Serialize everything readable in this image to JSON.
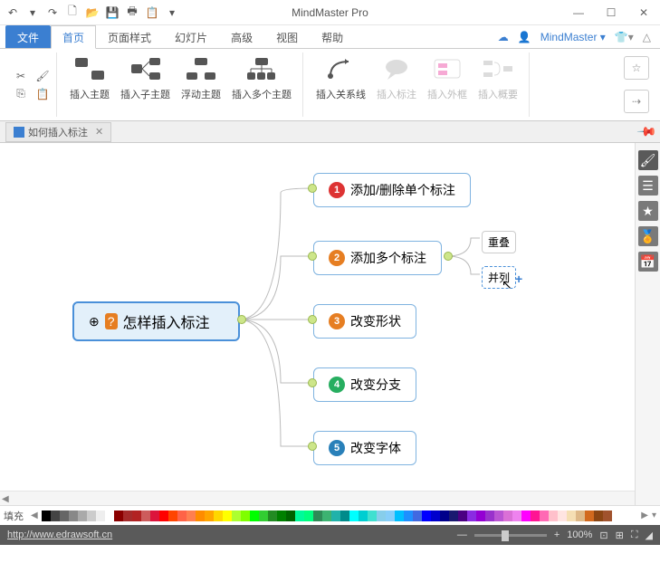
{
  "app": {
    "title": "MindMaster Pro",
    "brand": "MindMaster"
  },
  "tabs": {
    "file": "文件",
    "items": [
      "首页",
      "页面样式",
      "幻灯片",
      "高级",
      "视图",
      "帮助"
    ],
    "active": 0
  },
  "ribbon": {
    "insert_topic": "插入主题",
    "insert_subtopic": "插入子主题",
    "floating_topic": "浮动主题",
    "insert_multiple": "插入多个主题",
    "relationship": "插入关系线",
    "callout": "插入标注",
    "boundary": "插入外框",
    "summary": "插入概要"
  },
  "doc": {
    "name": "如何插入标注",
    "close": "✕"
  },
  "mindmap": {
    "center": "怎样插入标注",
    "nodes": [
      "添加/删除单个标注",
      "添加多个标注",
      "改变形状",
      "改变分支",
      "改变字体"
    ],
    "sub": {
      "overlap": "重叠",
      "side": "并列"
    }
  },
  "palette": {
    "label": "填充"
  },
  "status": {
    "url": "http://www.edrawsoft.cn",
    "zoom": "100%"
  },
  "colors": [
    "#000",
    "#444",
    "#666",
    "#888",
    "#aaa",
    "#ccc",
    "#eee",
    "#fff",
    "#8b0000",
    "#a52a2a",
    "#b22222",
    "#cd5c5c",
    "#dc143c",
    "#ff0000",
    "#ff4500",
    "#ff6347",
    "#ff7f50",
    "#ff8c00",
    "#ffa500",
    "#ffd700",
    "#ffff00",
    "#adff2f",
    "#7fff00",
    "#00ff00",
    "#32cd32",
    "#228b22",
    "#008000",
    "#006400",
    "#00fa9a",
    "#00ff7f",
    "#2e8b57",
    "#3cb371",
    "#20b2aa",
    "#008b8b",
    "#00ffff",
    "#00ced1",
    "#40e0d0",
    "#87ceeb",
    "#87cefa",
    "#00bfff",
    "#1e90ff",
    "#4169e1",
    "#0000ff",
    "#0000cd",
    "#00008b",
    "#191970",
    "#4b0082",
    "#8a2be2",
    "#9400d3",
    "#9932cc",
    "#ba55d3",
    "#da70d6",
    "#ee82ee",
    "#ff00ff",
    "#ff1493",
    "#ff69b4",
    "#ffc0cb",
    "#ffe4e1",
    "#f5deb3",
    "#deb887",
    "#d2691e",
    "#8b4513",
    "#a0522d"
  ]
}
